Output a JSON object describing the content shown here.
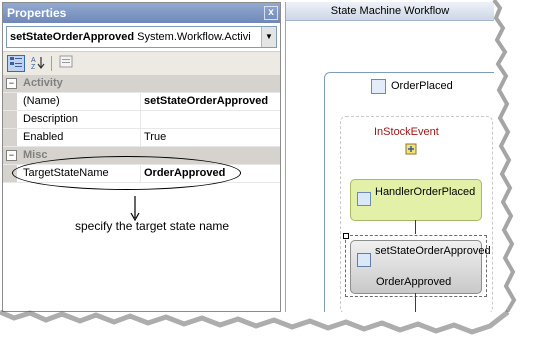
{
  "properties": {
    "title": "Properties",
    "close_label": "x",
    "selected_object_name": "setStateOrderApproved",
    "selected_object_type": "System.Workflow.Activi",
    "categories": [
      {
        "name": "Activity",
        "rows": [
          {
            "key": "(Name)",
            "value": "setStateOrderApproved",
            "bold": true
          },
          {
            "key": "Description",
            "value": ""
          },
          {
            "key": "Enabled",
            "value": "True"
          }
        ]
      },
      {
        "name": "Misc",
        "rows": [
          {
            "key": "TargetStateName",
            "value": "OrderApproved",
            "bold": true
          }
        ]
      }
    ]
  },
  "annotation": {
    "caption": "specify the target state name"
  },
  "designer": {
    "title": "State Machine Workflow",
    "state_name": "OrderPlaced",
    "event_name": "InStockEvent",
    "handler_name": "HandlerOrderPlaced",
    "setstate_name": "setStateOrderApproved",
    "setstate_target": "OrderApproved"
  }
}
